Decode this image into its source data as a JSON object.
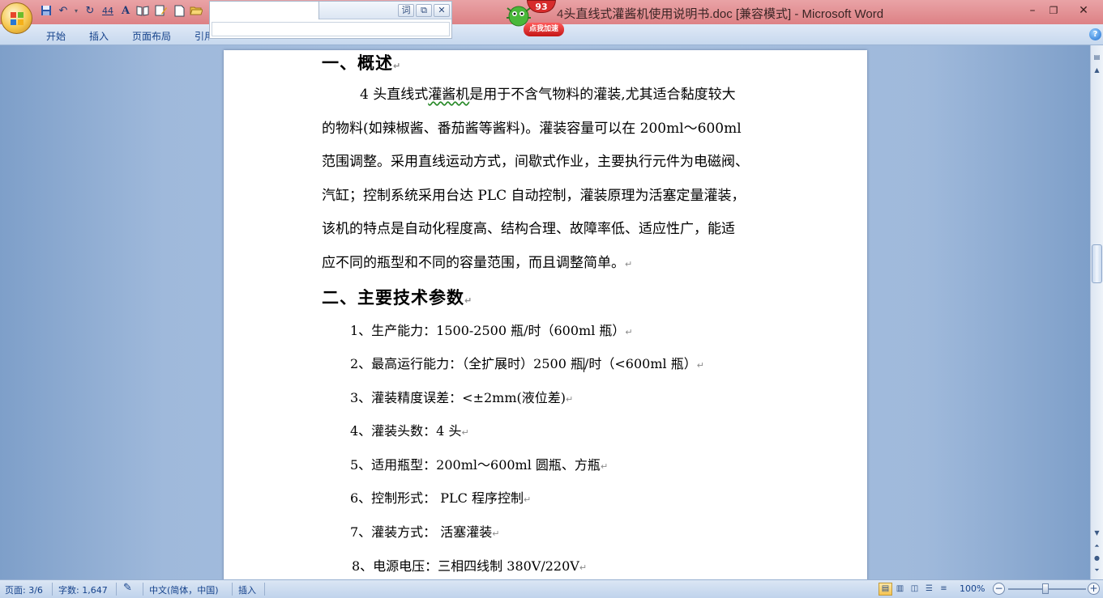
{
  "window": {
    "title_lead": "4",
    "title": "头直线式灌酱机使用说明书.doc [兼容模式] - Microsoft Word"
  },
  "badge": {
    "count": "93",
    "label": "点我加速"
  },
  "qat": {
    "icons": [
      "save-icon",
      "undo-icon",
      "redo-icon",
      "numbering-icon",
      "font-icon",
      "open-book-icon",
      "edit-icon",
      "new-document-icon",
      "folder-open-icon"
    ]
  },
  "ribbon": {
    "tabs": [
      "开始",
      "插入",
      "页面布局",
      "引用"
    ]
  },
  "popup": {
    "btn_1": "词",
    "btn_2": "⧉",
    "btn_3": "✕"
  },
  "document": {
    "h1": "一、概述",
    "p1_lead": "4 头直线式",
    "p1_squig": "灌酱机",
    "p1_rest": "是用于不含气物料的灌装,尤其适合黏度较大",
    "p2": "的物料(如辣椒酱、番茄酱等酱料)。灌装容量可以在  200ml～600ml",
    "p3": "范围调整。采用直线运动方式，间歇式作业，主要执行元件为电磁阀、",
    "p4": "汽缸；控制系统采用台达 PLC 自动控制，灌装原理为活塞定量灌装，",
    "p5": "该机的特点是自动化程度高、结构合理、故障率低、适应性广，能适",
    "p6": "应不同的瓶型和不同的容量范围，而且调整简单。",
    "h2": "二、主要技术参数",
    "item1": "1、生产能力：1500-2500 瓶/时（600ml 瓶）",
    "item2_a": "2、最高运行能力：（全扩展时）2500 瓶",
    "item2_b": "/时（<600ml 瓶）",
    "item3": "3、灌装精度误差：<±2mm(液位差)",
    "item4": "4、灌装头数：4 头",
    "item5": "5、适用瓶型：200ml～600ml 圆瓶、方瓶",
    "item6": "6、控制形式：  PLC 程序控制",
    "item7": "7、灌装方式：  活塞灌装",
    "item8": "8、电源电压：三相四线制       380V/220V",
    "para_mark": "↵"
  },
  "status": {
    "page": "页面: 3/6",
    "words": "字数: 1,647",
    "language": "中文(简体，中国)",
    "mode": "插入",
    "zoom": "100%"
  },
  "colors": {
    "title_bar": "#dd8185",
    "ribbon": "#c7d8ee",
    "workspace": "#aac2e0",
    "accent_text": "#15428b"
  }
}
